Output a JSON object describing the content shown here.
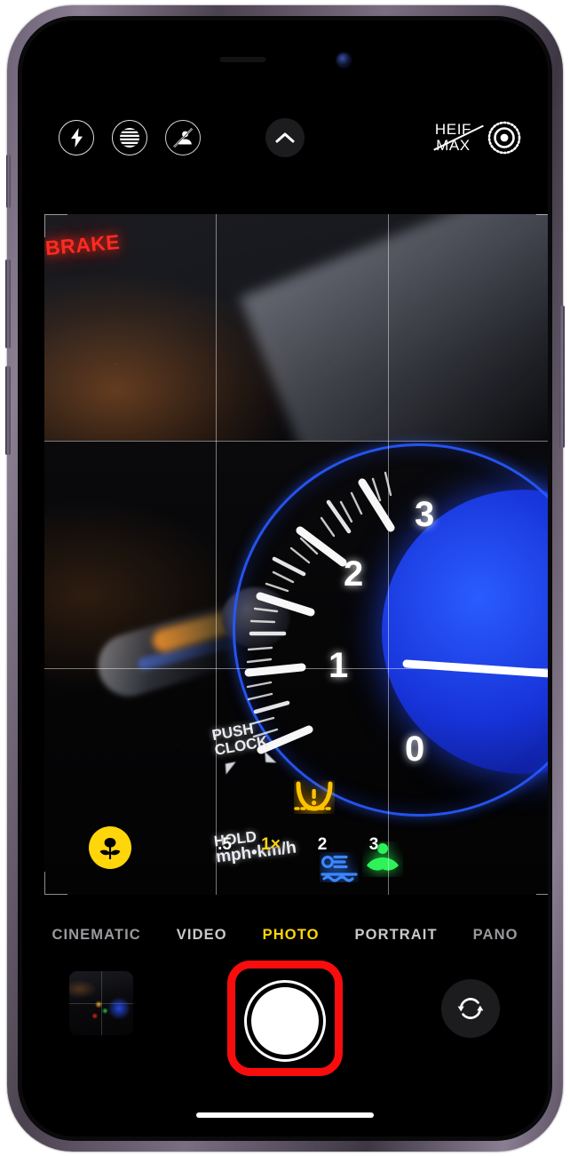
{
  "app": {
    "name": "Camera",
    "device": "iPhone"
  },
  "status_bar": {
    "speaker": "speaker-slot",
    "front_camera": "front-camera-lens"
  },
  "top_controls": {
    "flash": {
      "label": "Flash",
      "icon": "flash-bolt-icon",
      "state": "auto"
    },
    "night_mode": {
      "label": "Night Mode",
      "icon": "night-mode-icon",
      "state": "on"
    },
    "live_photo": {
      "label": "Live Photo Off",
      "icon": "live-photo-off-icon",
      "state": "off"
    },
    "expand": {
      "label": "More Controls",
      "icon": "chevron-up-icon"
    },
    "heif": {
      "line1": "HEIF",
      "line2": "MAX",
      "state": "off-strikethrough"
    },
    "raw_toggle": {
      "label": "ProRAW",
      "icon": "raw-target-icon"
    }
  },
  "viewfinder": {
    "grid_enabled": true,
    "macro": {
      "label": "Macro",
      "icon": "flower-macro-icon",
      "active": true,
      "color": "#ffd60a"
    },
    "zoom_levels": [
      {
        "label": ".5",
        "selected": false
      },
      {
        "label": "1×",
        "selected": true
      },
      {
        "label": "2",
        "selected": false
      },
      {
        "label": "3",
        "selected": false
      }
    ],
    "scene": {
      "description": "car-dashboard-at-night",
      "labels": [
        {
          "text": "PUSH",
          "name": "push-label"
        },
        {
          "text": "CLOCK",
          "name": "clock-label"
        },
        {
          "text": "HOLD",
          "name": "hold-label"
        },
        {
          "text": "mph•km/h",
          "name": "mph-kmh-label"
        },
        {
          "text": "BRAKE",
          "name": "brake-warning-label",
          "color": "#ff2b20"
        }
      ],
      "warning_lights": [
        {
          "name": "tire-pressure-icon",
          "color": "#ffb400"
        },
        {
          "name": "coolant-temp-icon",
          "color": "#2f7bff"
        },
        {
          "name": "eco-mode-icon",
          "color": "#27e34a"
        }
      ],
      "tachometer": {
        "ticks": [
          "0",
          "1",
          "2",
          "3"
        ],
        "dial_color": "#2a5cff"
      }
    }
  },
  "mode_selector": {
    "modes": [
      {
        "label": "CINEMATIC",
        "active": false
      },
      {
        "label": "VIDEO",
        "active": false
      },
      {
        "label": "PHOTO",
        "active": true
      },
      {
        "label": "PORTRAIT",
        "active": false
      },
      {
        "label": "PANO",
        "active": false
      }
    ],
    "active_color": "#ffd60a"
  },
  "shutter_row": {
    "thumbnail": {
      "name": "last-photo-thumbnail"
    },
    "shutter": {
      "label": "Take Photo",
      "highlighted": true,
      "highlight_color": "#f70d0d"
    },
    "flip": {
      "label": "Switch Camera",
      "icon": "camera-flip-icon"
    }
  },
  "home_indicator": {
    "name": "home-indicator"
  }
}
